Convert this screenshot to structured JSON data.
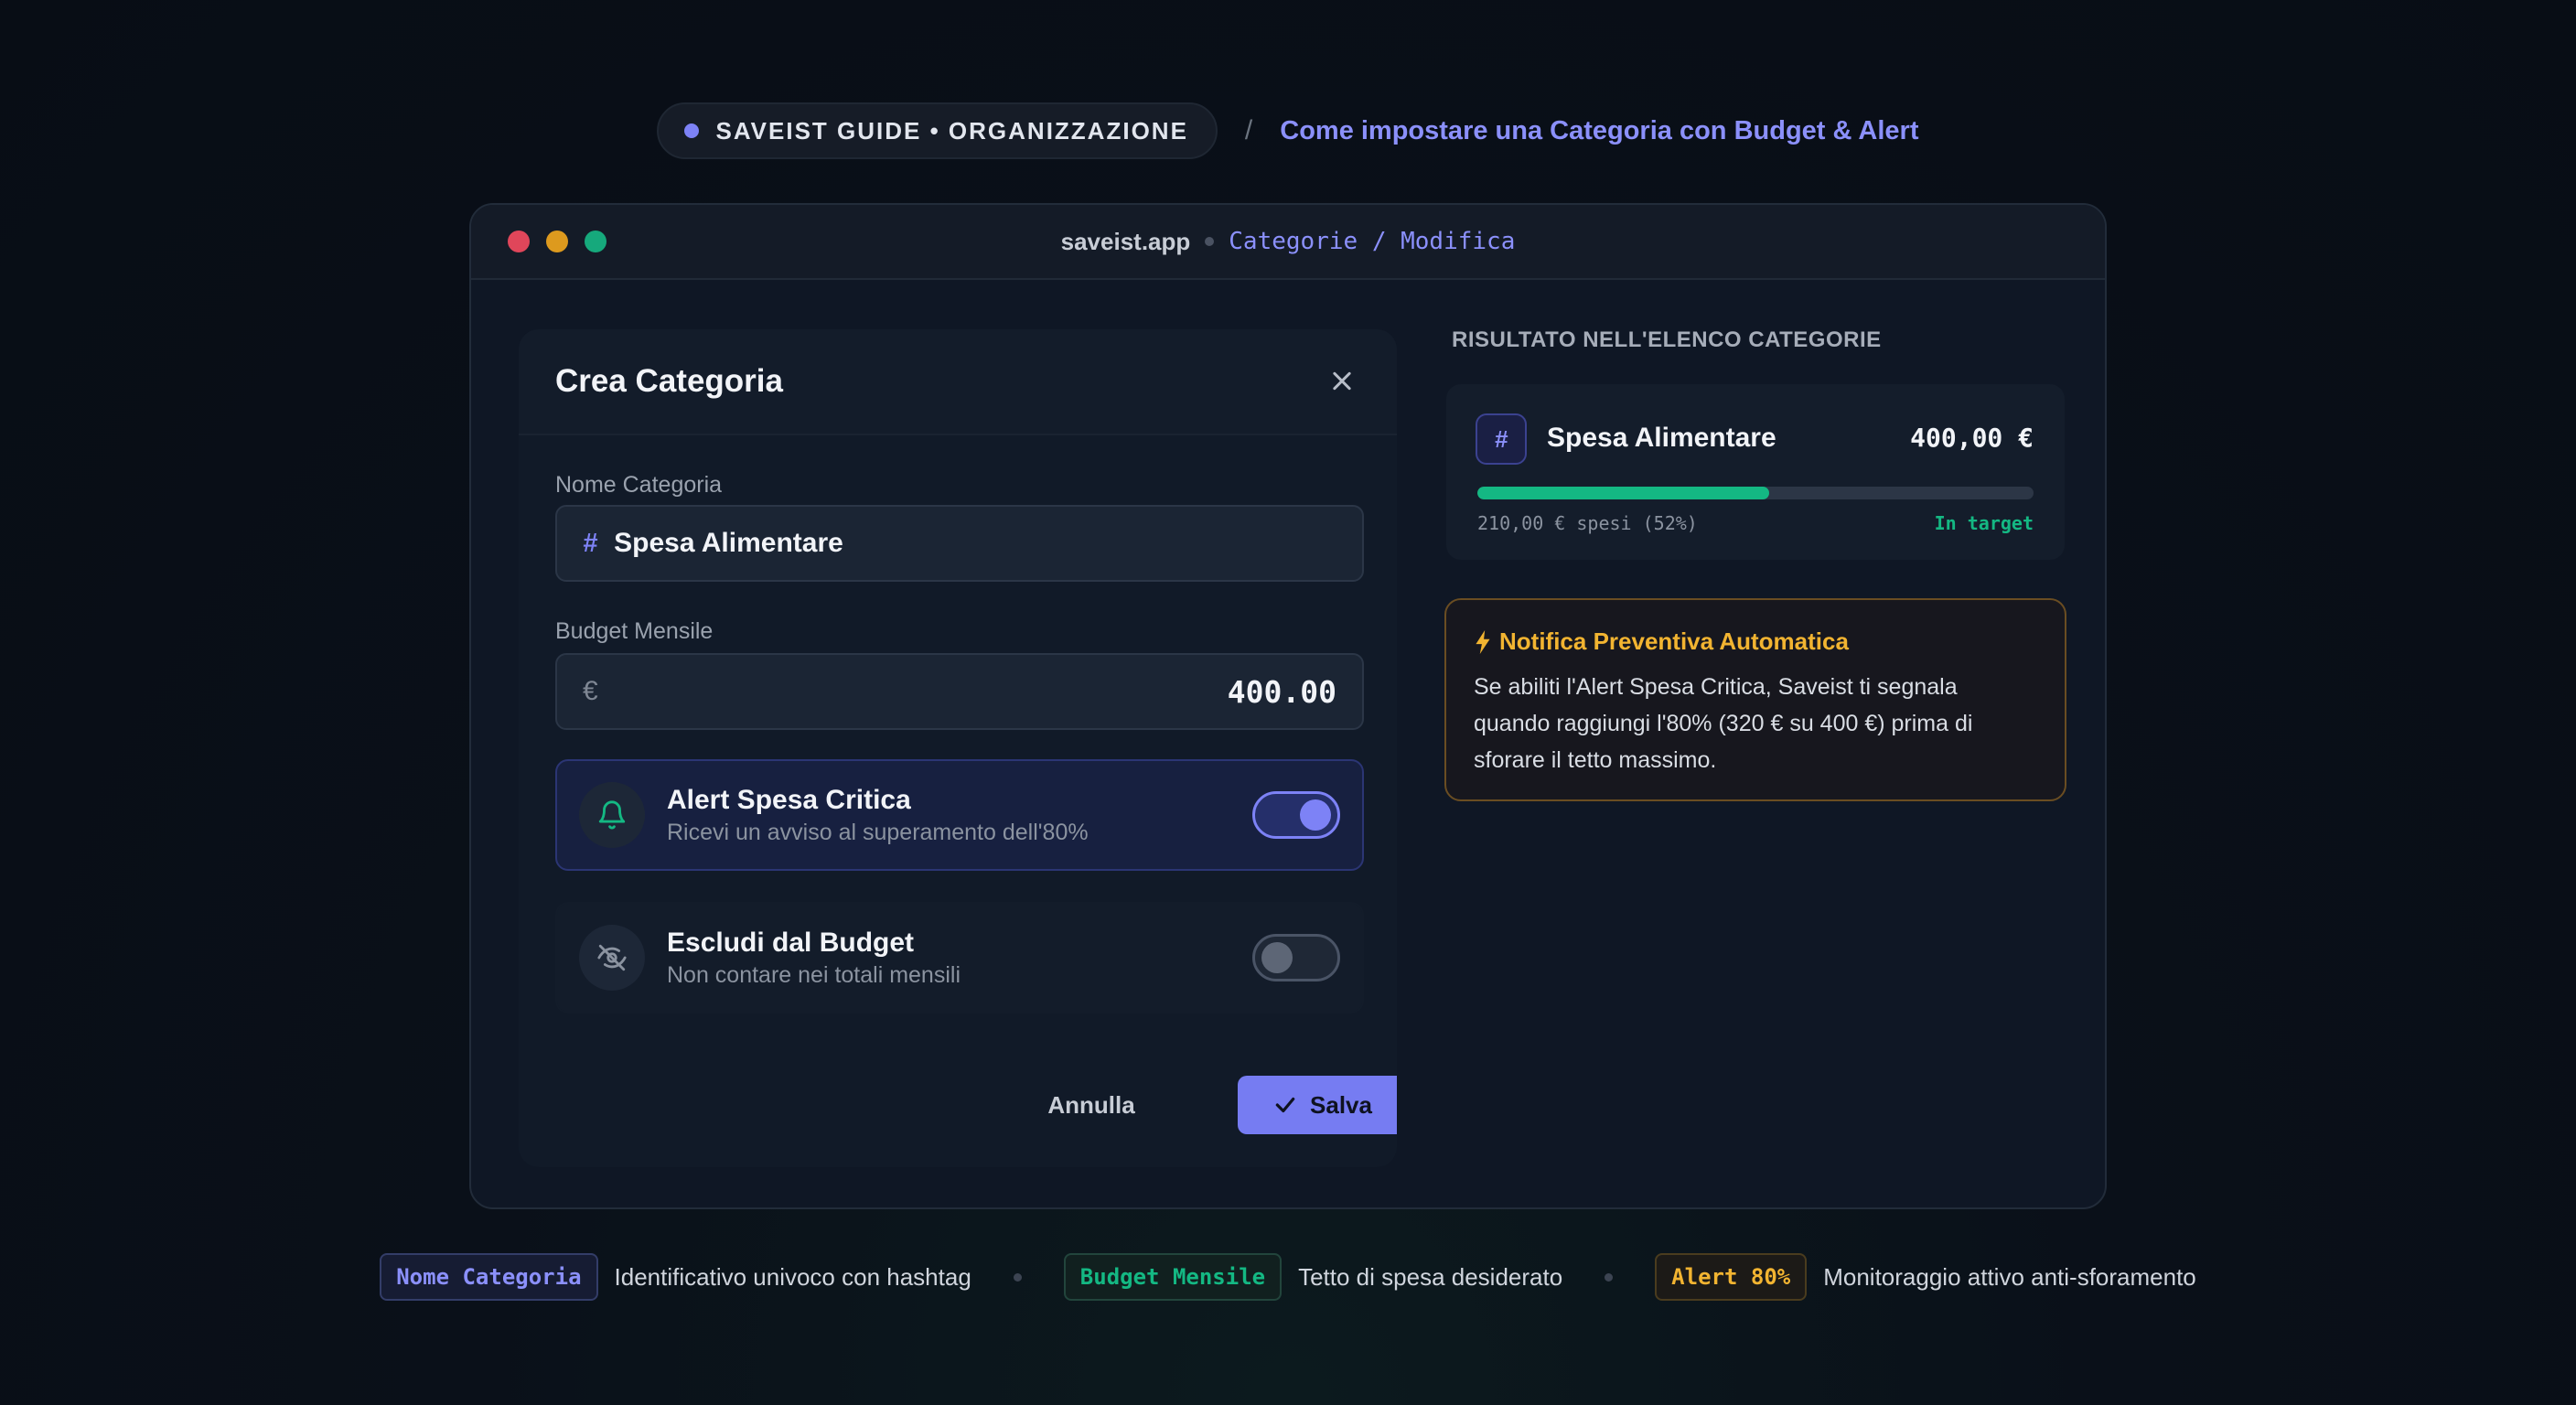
{
  "header": {
    "guide_label": "SAVEIST GUIDE • ORGANIZZAZIONE",
    "separator": "/",
    "title": "Come impostare una Categoria con Budget & Alert"
  },
  "window": {
    "host": "saveist.app",
    "path": "Categorie / Modifica"
  },
  "modal": {
    "title": "Crea Categoria",
    "name_label": "Nome Categoria",
    "name_prefix": "#",
    "name_value": "Spesa Alimentare",
    "budget_label": "Budget Mensile",
    "currency_symbol": "€",
    "budget_value": "400.00",
    "alert": {
      "title": "Alert Spesa Critica",
      "subtitle": "Ricevi un avviso al superamento dell'80%",
      "enabled": true
    },
    "exclude": {
      "title": "Escludi dal Budget",
      "subtitle": "Non contare nei totali mensili",
      "enabled": false
    },
    "cancel_label": "Annulla",
    "save_label": "Salva"
  },
  "result": {
    "section_label": "RISULTATO NELL'ELENCO CATEGORIE",
    "badge": "#",
    "name": "Spesa Alimentare",
    "amount": "400,00 €",
    "progress": 0.525,
    "spent_text": "210,00 € spesi (52%)",
    "status": "In target"
  },
  "notice": {
    "title": "Notifica Preventiva Automatica",
    "body": "Se abiliti l'Alert Spesa Critica, Saveist ti segnala quando raggiungi l'80% (320 € su 400 €) prima di sforare il tetto massimo."
  },
  "legend": [
    {
      "tag": "Nome Categoria",
      "text": "Identificativo univoco con hashtag"
    },
    {
      "tag": "Budget Mensile",
      "text": "Tetto di spesa desiderato"
    },
    {
      "tag": "Alert 80%",
      "text": "Monitoraggio attivo anti-sforamento"
    }
  ],
  "colors": {
    "accent": "#7d82f6",
    "success": "#14b883",
    "warning": "#f2b431",
    "background": "#0a1019"
  }
}
